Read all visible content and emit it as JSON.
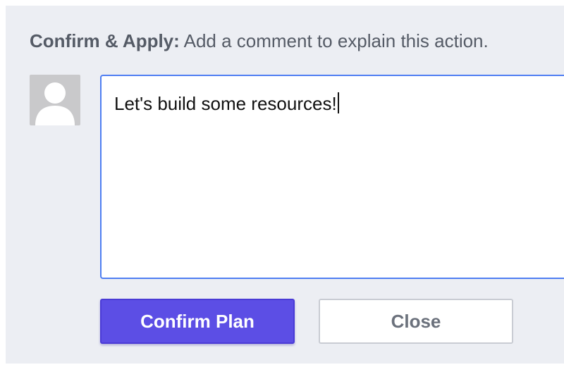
{
  "prompt": {
    "label": "Confirm & Apply:",
    "text": "Add a comment to explain this action."
  },
  "avatar": {
    "icon": "user-silhouette-icon"
  },
  "comment": {
    "value": "Let's build some resources!"
  },
  "buttons": {
    "confirm_label": "Confirm Plan",
    "close_label": "Close"
  },
  "colors": {
    "panel_bg": "#eceef3",
    "primary": "#5c4ee5",
    "focus_border": "#4f7ef2"
  }
}
